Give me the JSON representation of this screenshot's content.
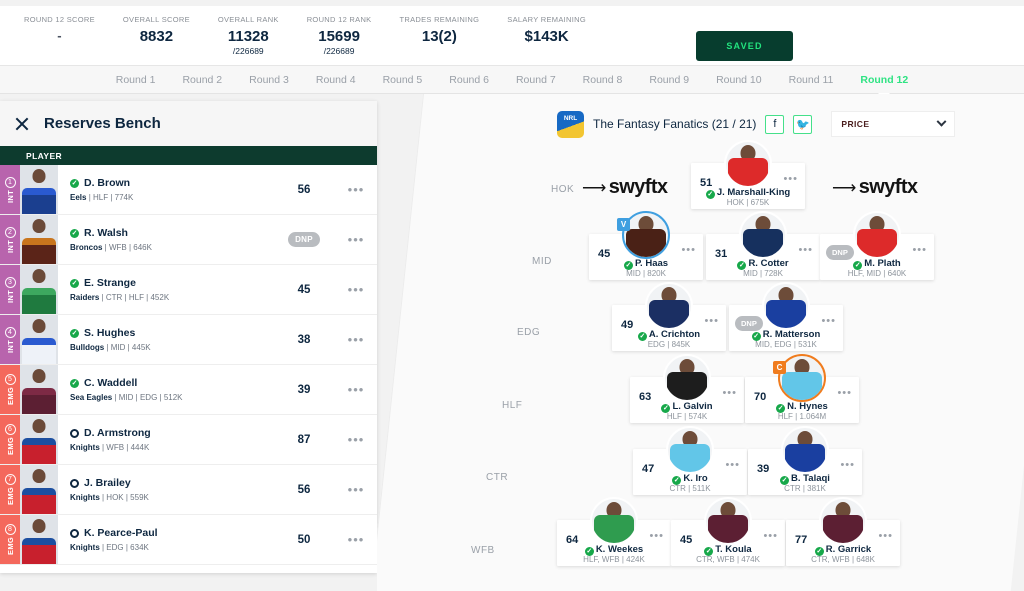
{
  "topbar": {
    "stats": [
      {
        "label": "ROUND 12 SCORE",
        "value": "-",
        "sub": ""
      },
      {
        "label": "OVERALL SCORE",
        "value": "8832",
        "sub": ""
      },
      {
        "label": "OVERALL RANK",
        "value": "11328",
        "sub": "/226689"
      },
      {
        "label": "ROUND 12 RANK",
        "value": "15699",
        "sub": "/226689"
      },
      {
        "label": "TRADES REMAINING",
        "value": "13(2)",
        "sub": ""
      },
      {
        "label": "SALARY REMAINING",
        "value": "$143K",
        "sub": ""
      }
    ],
    "saved_label": "SAVED"
  },
  "rounds": {
    "tabs": [
      {
        "label": "Round 1",
        "active": false
      },
      {
        "label": "Round 2",
        "active": false
      },
      {
        "label": "Round 3",
        "active": false
      },
      {
        "label": "Round 4",
        "active": false
      },
      {
        "label": "Round 5",
        "active": false
      },
      {
        "label": "Round 6",
        "active": false
      },
      {
        "label": "Round 7",
        "active": false
      },
      {
        "label": "Round 8",
        "active": false
      },
      {
        "label": "Round 9",
        "active": false
      },
      {
        "label": "Round 10",
        "active": false
      },
      {
        "label": "Round 11",
        "active": false
      },
      {
        "label": "Round 12",
        "active": true
      }
    ]
  },
  "reserves": {
    "title": "Reserves Bench",
    "column_header": "PLAYER",
    "colors": {
      "int": "#b864ad",
      "emg": "#f4685c"
    },
    "players": [
      {
        "slot": "INT",
        "num": "1",
        "status": "ok",
        "name": "D. Brown",
        "club": "Eels",
        "positions": "HLF",
        "price": "774K",
        "score": "56",
        "dnp": false,
        "jersey": "#1b3f8f",
        "jersey2": "#2a5ad0"
      },
      {
        "slot": "INT",
        "num": "2",
        "status": "ok",
        "name": "R. Walsh",
        "club": "Broncos",
        "positions": "WFB",
        "price": "646K",
        "score": "DNP",
        "dnp": true,
        "jersey": "#5b2418",
        "jersey2": "#c9751d"
      },
      {
        "slot": "INT",
        "num": "3",
        "status": "ok",
        "name": "E. Strange",
        "club": "Raiders",
        "positions": "CTR | HLF",
        "price": "452K",
        "score": "45",
        "dnp": false,
        "jersey": "#1f7a3f",
        "jersey2": "#3da85f"
      },
      {
        "slot": "INT",
        "num": "4",
        "status": "ok",
        "name": "S. Hughes",
        "club": "Bulldogs",
        "positions": "MID",
        "price": "445K",
        "score": "38",
        "dnp": false,
        "jersey": "#eef2f8",
        "jersey2": "#2a5ad0"
      },
      {
        "slot": "EMG",
        "num": "5",
        "status": "ok",
        "name": "C. Waddell",
        "club": "Sea Eagles",
        "positions": "MID | EDG",
        "price": "512K",
        "score": "39",
        "dnp": false,
        "jersey": "#5c1f33",
        "jersey2": "#7d2a45"
      },
      {
        "slot": "EMG",
        "num": "6",
        "status": "ring",
        "name": "D. Armstrong",
        "club": "Knights",
        "positions": "WFB",
        "price": "444K",
        "score": "87",
        "dnp": false,
        "jersey": "#c8202d",
        "jersey2": "#1c4fa0"
      },
      {
        "slot": "EMG",
        "num": "7",
        "status": "ring",
        "name": "J. Brailey",
        "club": "Knights",
        "positions": "HOK",
        "price": "559K",
        "score": "56",
        "dnp": false,
        "jersey": "#c8202d",
        "jersey2": "#1c4fa0"
      },
      {
        "slot": "EMG",
        "num": "8",
        "status": "ring",
        "name": "K. Pearce-Paul",
        "club": "Knights",
        "positions": "EDG",
        "price": "634K",
        "score": "50",
        "dnp": false,
        "jersey": "#c8202d",
        "jersey2": "#1c4fa0"
      }
    ]
  },
  "field": {
    "team_name": "The Fantasy Fanatics (21 / 21)",
    "logo_text": "NRL",
    "facebook_icon": "f",
    "twitter_icon": "🐦",
    "price_label": "PRICE",
    "sponsor": "swyftx",
    "position_labels": [
      "HOK",
      "MID",
      "EDG",
      "HLF",
      "CTR",
      "WFB"
    ],
    "players": [
      {
        "row": "HOK",
        "score": "51",
        "dnp": false,
        "badge": "",
        "name": "J. Marshall-King",
        "meta": "HOK | 675K",
        "jersey": "#dd2a2a"
      },
      {
        "row": "MID",
        "score": "45",
        "dnp": false,
        "badge": "V",
        "name": "P. Haas",
        "meta": "MID | 820K",
        "jersey": "#4a2116"
      },
      {
        "row": "MID",
        "score": "31",
        "dnp": false,
        "badge": "",
        "name": "R. Cotter",
        "meta": "MID | 728K",
        "jersey": "#16305e"
      },
      {
        "row": "MID",
        "score": "DNP",
        "dnp": true,
        "badge": "",
        "name": "M. Plath",
        "meta": "HLF, MID | 640K",
        "jersey": "#dd2a2a"
      },
      {
        "row": "EDG",
        "score": "49",
        "dnp": false,
        "badge": "",
        "name": "A. Crichton",
        "meta": "EDG | 845K",
        "jersey": "#1b2f63"
      },
      {
        "row": "EDG",
        "score": "DNP",
        "dnp": true,
        "badge": "",
        "name": "R. Matterson",
        "meta": "MID, EDG | 531K",
        "jersey": "#1a3fa0"
      },
      {
        "row": "HLF",
        "score": "63",
        "dnp": false,
        "badge": "",
        "name": "L. Galvin",
        "meta": "HLF | 574K",
        "jersey": "#1d1d1d"
      },
      {
        "row": "HLF",
        "score": "70",
        "dnp": false,
        "badge": "C",
        "name": "N. Hynes",
        "meta": "HLF | 1.064M",
        "jersey": "#62c6e8"
      },
      {
        "row": "CTR",
        "score": "47",
        "dnp": false,
        "badge": "",
        "name": "K. Iro",
        "meta": "CTR | 511K",
        "jersey": "#62c6e8"
      },
      {
        "row": "CTR",
        "score": "39",
        "dnp": false,
        "badge": "",
        "name": "B. Talaqi",
        "meta": "CTR | 381K",
        "jersey": "#1a3fa0"
      },
      {
        "row": "WFB",
        "score": "64",
        "dnp": false,
        "badge": "",
        "name": "K. Weekes",
        "meta": "HLF, WFB | 424K",
        "jersey": "#2f9c4f"
      },
      {
        "row": "WFB",
        "score": "45",
        "dnp": false,
        "badge": "",
        "name": "T. Koula",
        "meta": "CTR, WFB | 474K",
        "jersey": "#5c1f33"
      },
      {
        "row": "WFB",
        "score": "77",
        "dnp": false,
        "badge": "",
        "name": "R. Garrick",
        "meta": "CTR, WFB | 648K",
        "jersey": "#5c1f33"
      }
    ]
  }
}
